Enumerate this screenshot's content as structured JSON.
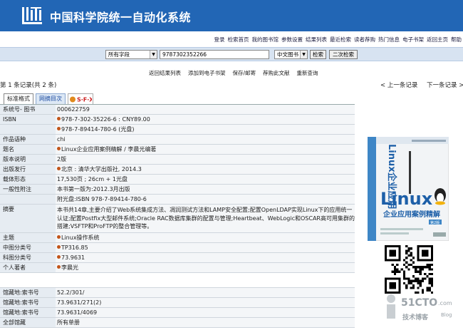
{
  "header": {
    "title": "中国科学院统一自动化系统",
    "accent": "#2266b5"
  },
  "top_links": [
    "登录",
    "检索首页",
    "我的图书馆",
    "参数设置",
    "结果列表",
    "最近检索",
    "读者荐购",
    "热门信息",
    "电子书架",
    "返回主页",
    "帮助"
  ],
  "search": {
    "field": "所有字段",
    "query": "9787302352266",
    "database": "中文图书",
    "search_label": "检索",
    "secondary_label": "二次检索"
  },
  "actions": [
    "返回结果列表",
    "添加到电子书架",
    "保存/邮寄",
    "荐购此文献",
    "重新查询"
  ],
  "record_nav": {
    "count": "第 1 条记录(共 2 条)",
    "prev": "< 上一条记录",
    "next": "下一条记录 >"
  },
  "tabs": [
    "标准格式",
    "网摘目次",
    "S·F·X"
  ],
  "record": [
    {
      "label": "系统号- 图书",
      "value": "000622759",
      "bullet": false
    },
    {
      "label": "ISBN",
      "value": "978-7-302-35226-6 : CNY89.00",
      "bullet": true
    },
    {
      "label": "",
      "value": "978-7-89414-780-6 (光盘)",
      "bullet": true
    },
    {
      "label": "作品语种",
      "value": "chi",
      "bullet": false
    },
    {
      "label": "题名",
      "value": "Linux企业应用案例精解 / 李晨光编著",
      "bullet": true
    },
    {
      "label": "版本说明",
      "value": "2版",
      "bullet": false
    },
    {
      "label": "出版发行",
      "value": "北京 : 清华大学出版社, 2014.3",
      "bullet": true
    },
    {
      "label": "载体形态",
      "value": "17,530页 ; 26cm + 1光盘",
      "bullet": false
    },
    {
      "label": "一般性附注",
      "value": "本书第一版为:2012.3月出版",
      "bullet": false
    },
    {
      "label": "",
      "value": "附光盘:ISBN 978-7-89414-780-6",
      "bullet": false
    },
    {
      "label": "摘要",
      "value": "本书共14章,主要介绍了Web系统集成方法、凋润测试方法和LAMP安全配置;配置OpenLDAP实现Linux下的应用统一认证;配置Postfix大型邮件系统;Oracle RAC数据库集群的配置与管理;Heartbeat、WebLogic和OSCAR高可用集群的搭建;VSFTP和ProFTP的整合管理等。",
      "bullet": false,
      "tall": true
    },
    {
      "label": "主题",
      "value": "Linux操作系统",
      "bullet": true
    },
    {
      "label": "中图分类号",
      "value": "TP316.85",
      "bullet": true
    },
    {
      "label": "科图分类号",
      "value": "73.9631",
      "bullet": true
    },
    {
      "label": "个人著者",
      "value": "李晨光",
      "bullet": true
    },
    {
      "gap": true
    },
    {
      "label": "馆藏地:索书号",
      "value": "52.2/301/",
      "bullet": false
    },
    {
      "label": "馆藏地:索书号",
      "value": "73.9631/271(2)",
      "bullet": false
    },
    {
      "label": "馆藏地:索书号",
      "value": "73.9631/4069",
      "bullet": false
    },
    {
      "label": "全部馆藏",
      "value": "所有单册",
      "bullet": false
    }
  ],
  "cover": {
    "title": "Linux",
    "subtitle": "企业应用案例精解",
    "badge": "第2版"
  },
  "watermark": {
    "main": "51CTO",
    "com": ".com",
    "sub": "技术博客",
    "blog": "Blog"
  }
}
